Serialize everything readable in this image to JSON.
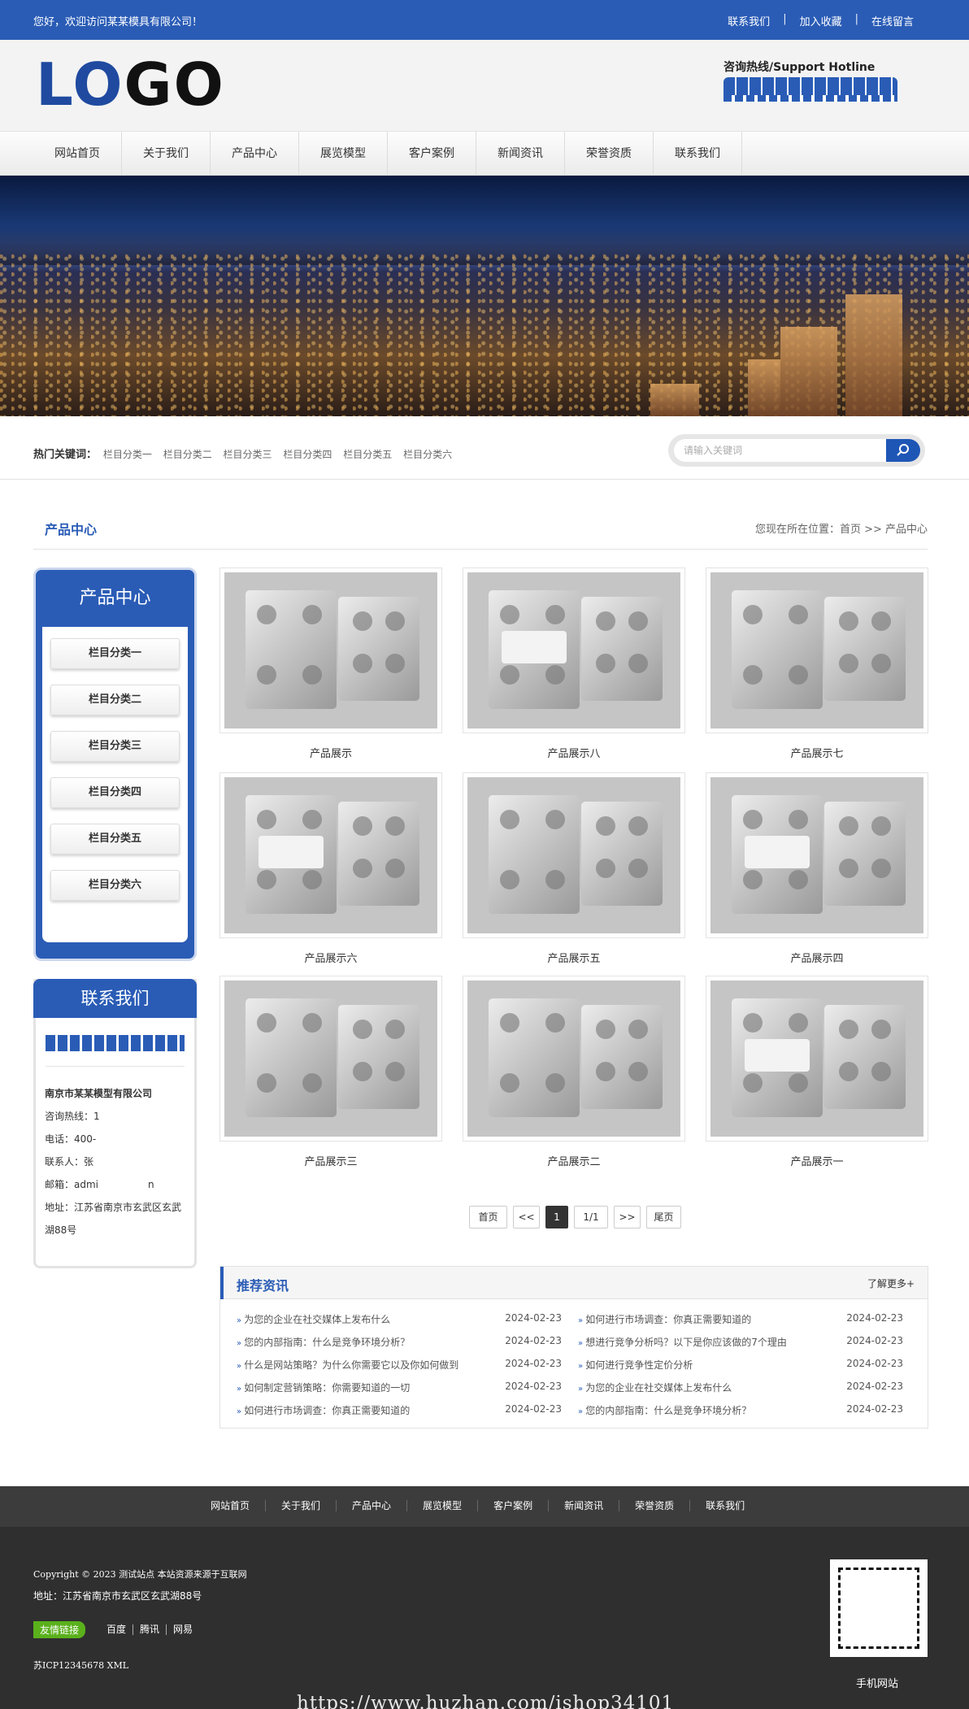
{
  "topbar": {
    "welcome": "您好，欢迎访问某某模具有限公司！",
    "links": [
      "联系我们",
      "加入收藏",
      "在线留言"
    ],
    "separator": "|"
  },
  "header": {
    "logo_part1": "LO",
    "logo_part2": "GO",
    "hotline_title": "咨询热线/Support Hotline"
  },
  "nav": {
    "items": [
      "网站首页",
      "关于我们",
      "产品中心",
      "展览模型",
      "客户案例",
      "新闻资讯",
      "荣誉资质",
      "联系我们"
    ]
  },
  "search": {
    "hot_label": "热门关键词：",
    "keywords": [
      "栏目分类一",
      "栏目分类二",
      "栏目分类三",
      "栏目分类四",
      "栏目分类五",
      "栏目分类六"
    ],
    "placeholder": "请输入关键词"
  },
  "crumb": {
    "title": "产品中心",
    "position": "您现在所在位置：首页 >> 产品中心"
  },
  "sidebar": {
    "title": "产品中心",
    "items": [
      "栏目分类一",
      "栏目分类二",
      "栏目分类三",
      "栏目分类四",
      "栏目分类五",
      "栏目分类六"
    ]
  },
  "contact": {
    "title": "联系我们",
    "company": "南京市某某模型有限公司",
    "lines": [
      "咨询热线：1",
      "电话：400-",
      "联系人：张",
      "邮箱：admi                n",
      "地址：江苏省南京市玄武区玄武湖88号"
    ]
  },
  "products": [
    {
      "name": "产品展示"
    },
    {
      "name": "产品展示八"
    },
    {
      "name": "产品展示七"
    },
    {
      "name": "产品展示六"
    },
    {
      "name": "产品展示五"
    },
    {
      "name": "产品展示四"
    },
    {
      "name": "产品展示三"
    },
    {
      "name": "产品展示二"
    },
    {
      "name": "产品展示一"
    }
  ],
  "pager": {
    "first": "首页",
    "prev": "<<",
    "current": "1",
    "total": "1/1",
    "next": ">>",
    "last": "尾页"
  },
  "news": {
    "title": "推荐资讯",
    "more": "了解更多+",
    "left": [
      {
        "title": "为您的企业在社交媒体上发布什么",
        "date": "2024-02-23"
      },
      {
        "title": "您的内部指南：什么是竞争环境分析？",
        "date": "2024-02-23"
      },
      {
        "title": "什么是网站策略？为什么你需要它以及你如何做到",
        "date": "2024-02-23"
      },
      {
        "title": "如何制定营销策略：你需要知道的一切",
        "date": "2024-02-23"
      },
      {
        "title": "如何进行市场调查：你真正需要知道的",
        "date": "2024-02-23"
      }
    ],
    "right": [
      {
        "title": "如何进行市场调查：你真正需要知道的",
        "date": "2024-02-23"
      },
      {
        "title": "想进行竞争分析吗？以下是你应该做的7个理由",
        "date": "2024-02-23"
      },
      {
        "title": "如何进行竞争性定价分析",
        "date": "2024-02-23"
      },
      {
        "title": "为您的企业在社交媒体上发布什么",
        "date": "2024-02-23"
      },
      {
        "title": "您的内部指南：什么是竞争环境分析？",
        "date": "2024-02-23"
      }
    ]
  },
  "footer": {
    "nav": [
      "网站首页",
      "关于我们",
      "产品中心",
      "展览模型",
      "客户案例",
      "新闻资讯",
      "荣誉资质",
      "联系我们"
    ],
    "copyright": "Copyright © 2023 测试站点 本站资源来源于互联网",
    "address": "地址：江苏省南京市玄武区玄武湖88号",
    "friend_label": "友情链接",
    "friend_links": [
      "百度",
      "腾讯",
      "网易"
    ],
    "icp": "苏ICP12345678 XML",
    "qr_label": "手机网站",
    "watermark": "https://www.huzhan.com/ishop34101"
  },
  "colors": {
    "primary": "#2a5cb6",
    "footer_dark": "#2f2f2f",
    "friend_tag": "#5ab11c"
  }
}
